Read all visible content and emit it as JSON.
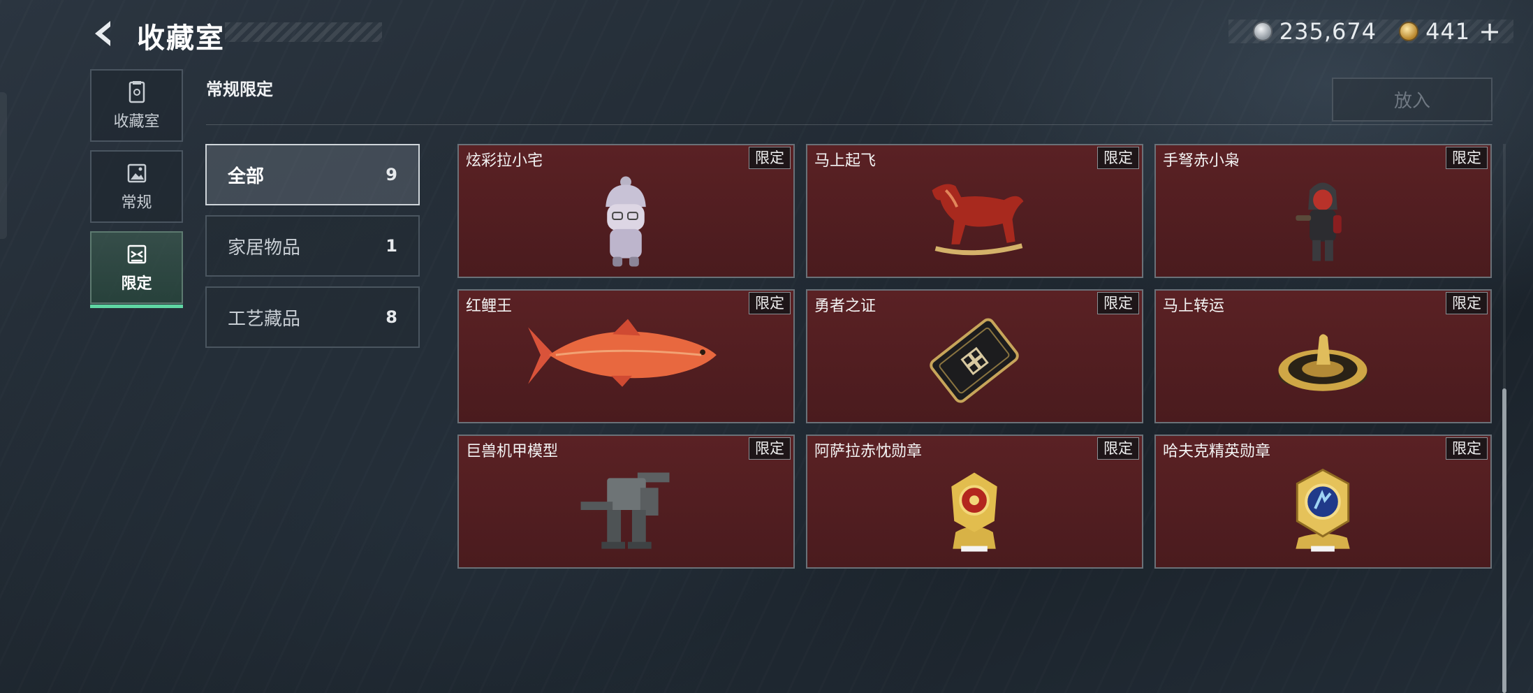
{
  "header": {
    "title": "收藏室"
  },
  "currency": {
    "silver_value": "235,674",
    "gold_value": "441",
    "plus": "+"
  },
  "rail": [
    {
      "label": "收藏室",
      "icon": "collection-icon"
    },
    {
      "label": "常规",
      "icon": "image-icon"
    },
    {
      "label": "限定",
      "icon": "limited-icon",
      "active": true
    }
  ],
  "section": {
    "title": "常规限定",
    "put_label": "放入"
  },
  "categories": [
    {
      "name": "全部",
      "count": "9",
      "active": true
    },
    {
      "name": "家居物品",
      "count": "1"
    },
    {
      "name": "工艺藏品",
      "count": "8"
    }
  ],
  "items": [
    {
      "name": "炫彩拉小宅",
      "badge": "限定",
      "art": "doll-figure-icon"
    },
    {
      "name": "马上起飞",
      "badge": "限定",
      "art": "rocking-horse-icon"
    },
    {
      "name": "手弩赤小枭",
      "badge": "限定",
      "art": "hooded-figure-icon"
    },
    {
      "name": "红鲤王",
      "badge": "限定",
      "art": "red-carp-icon"
    },
    {
      "name": "勇者之证",
      "badge": "限定",
      "art": "black-card-icon"
    },
    {
      "name": "马上转运",
      "badge": "限定",
      "art": "horse-dial-icon"
    },
    {
      "name": "巨兽机甲模型",
      "badge": "限定",
      "art": "mech-model-icon"
    },
    {
      "name": "阿萨拉赤忱勋章",
      "badge": "限定",
      "art": "red-medal-icon"
    },
    {
      "name": "哈夫克精英勋章",
      "badge": "限定",
      "art": "blue-medal-icon"
    }
  ],
  "colors": {
    "card_bg": "#5a2124",
    "accent": "#5fd6a3",
    "badge_bg": "#141416"
  }
}
